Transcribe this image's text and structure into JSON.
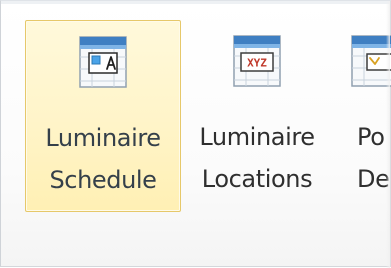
{
  "ribbon": {
    "buttons": [
      {
        "line1": "Luminaire",
        "line2": "Schedule",
        "icon": "schedule-table-icon",
        "state": "active"
      },
      {
        "line1": "Luminaire",
        "line2": "Locations",
        "icon": "locations-table-icon",
        "icon_text": "XYZ"
      },
      {
        "line1": "Po",
        "line2": "Der",
        "icon": "partial-table-icon"
      }
    ]
  },
  "colors": {
    "active_background": "#fff4c8",
    "active_border": "#e6c86a",
    "icon_header": "#3f7fc2"
  }
}
